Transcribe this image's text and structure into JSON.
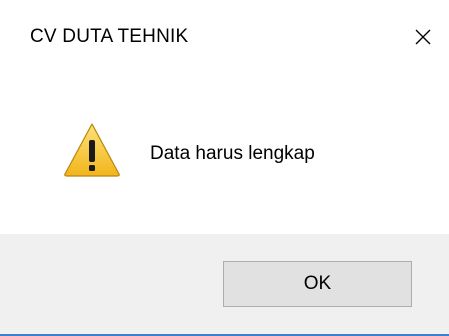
{
  "window": {
    "title": "CV DUTA TEHNIK",
    "close_icon": "close-icon"
  },
  "content": {
    "icon": "warning-icon",
    "message": "Data harus lengkap"
  },
  "footer": {
    "ok_label": "OK"
  },
  "colors": {
    "footer_bg": "#f0f0f0",
    "button_bg": "#e1e1e1",
    "button_border": "#adadad",
    "warning_yellow": "#f8cf3a",
    "accent_edge": "#3c7fcf"
  }
}
